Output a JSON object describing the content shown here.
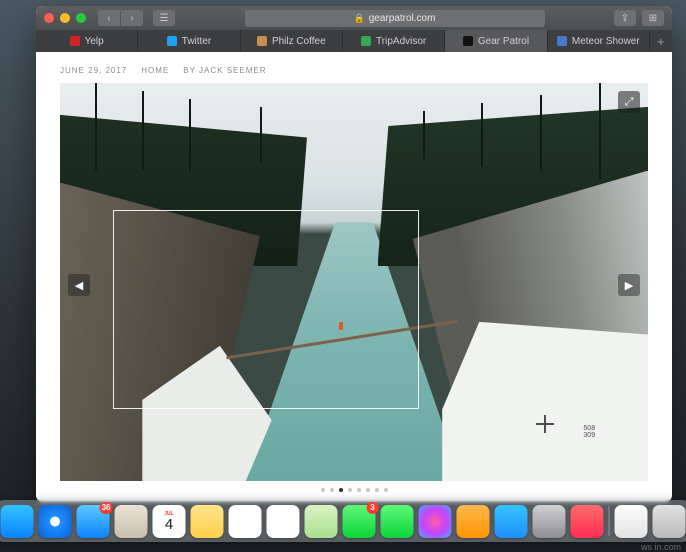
{
  "browser": {
    "address": "gearpatrol.com",
    "tabs": [
      {
        "label": "Yelp",
        "icon_color": "#d32323"
      },
      {
        "label": "Twitter",
        "icon_color": "#1da1f2"
      },
      {
        "label": "Philz Coffee",
        "icon_color": "#c98f4d"
      },
      {
        "label": "TripAdvisor",
        "icon_color": "#34a853"
      },
      {
        "label": "Gear Patrol",
        "icon_color": "#111111"
      },
      {
        "label": "Meteor Shower",
        "icon_color": "#4a78c9"
      }
    ],
    "active_tab_index": 4
  },
  "article": {
    "date": "JUNE 29, 2017",
    "category": "HOME",
    "byline_prefix": "By",
    "author": "JACK SEEMER"
  },
  "gallery": {
    "slide_count": 8,
    "active_slide_index": 2
  },
  "screenshot_selection": {
    "cursor_x": "508",
    "cursor_y": "309"
  },
  "dock": {
    "apps": [
      {
        "name": "finder",
        "bg": "linear-gradient(#33c1ff,#0a84ff)"
      },
      {
        "name": "safari",
        "bg": "radial-gradient(circle at 50% 50%,#fff 20%,#1e90ff 22%,#0a60d6 100%)"
      },
      {
        "name": "mail",
        "bg": "linear-gradient(#5ec7ff,#0a84ff)",
        "badge": "36"
      },
      {
        "name": "contacts",
        "bg": "linear-gradient(#e9e2d6,#c9bfa9)"
      },
      {
        "name": "calendar",
        "bg": "#ffffff",
        "badge_text": "4"
      },
      {
        "name": "notes",
        "bg": "linear-gradient(#ffe28a,#ffd24d)"
      },
      {
        "name": "reminders",
        "bg": "#ffffff"
      },
      {
        "name": "photos",
        "bg": "#ffffff"
      },
      {
        "name": "maps",
        "bg": "linear-gradient(#d9f2c4,#a8e08d)"
      },
      {
        "name": "messages",
        "bg": "linear-gradient(#5df776,#0bd63b)",
        "badge": "3"
      },
      {
        "name": "facetime",
        "bg": "linear-gradient(#5df776,#0bd63b)"
      },
      {
        "name": "itunes",
        "bg": "radial-gradient(circle,#ff5ea8,#c643fc,#4aa8ff)"
      },
      {
        "name": "ibooks",
        "bg": "linear-gradient(#ffb84d,#ff9500)"
      },
      {
        "name": "appstore",
        "bg": "linear-gradient(#35c3ff,#1f8fff)"
      },
      {
        "name": "preferences",
        "bg": "linear-gradient(#d0d0d4,#8e8e93)"
      },
      {
        "name": "news",
        "bg": "linear-gradient(#ff6b6b,#ff2d55)"
      }
    ],
    "pinned": [
      {
        "name": "document",
        "bg": "linear-gradient(#fff,#e2e2e2)"
      },
      {
        "name": "trash",
        "bg": "linear-gradient(#e2e2e2,#b9b9b9)"
      }
    ]
  }
}
